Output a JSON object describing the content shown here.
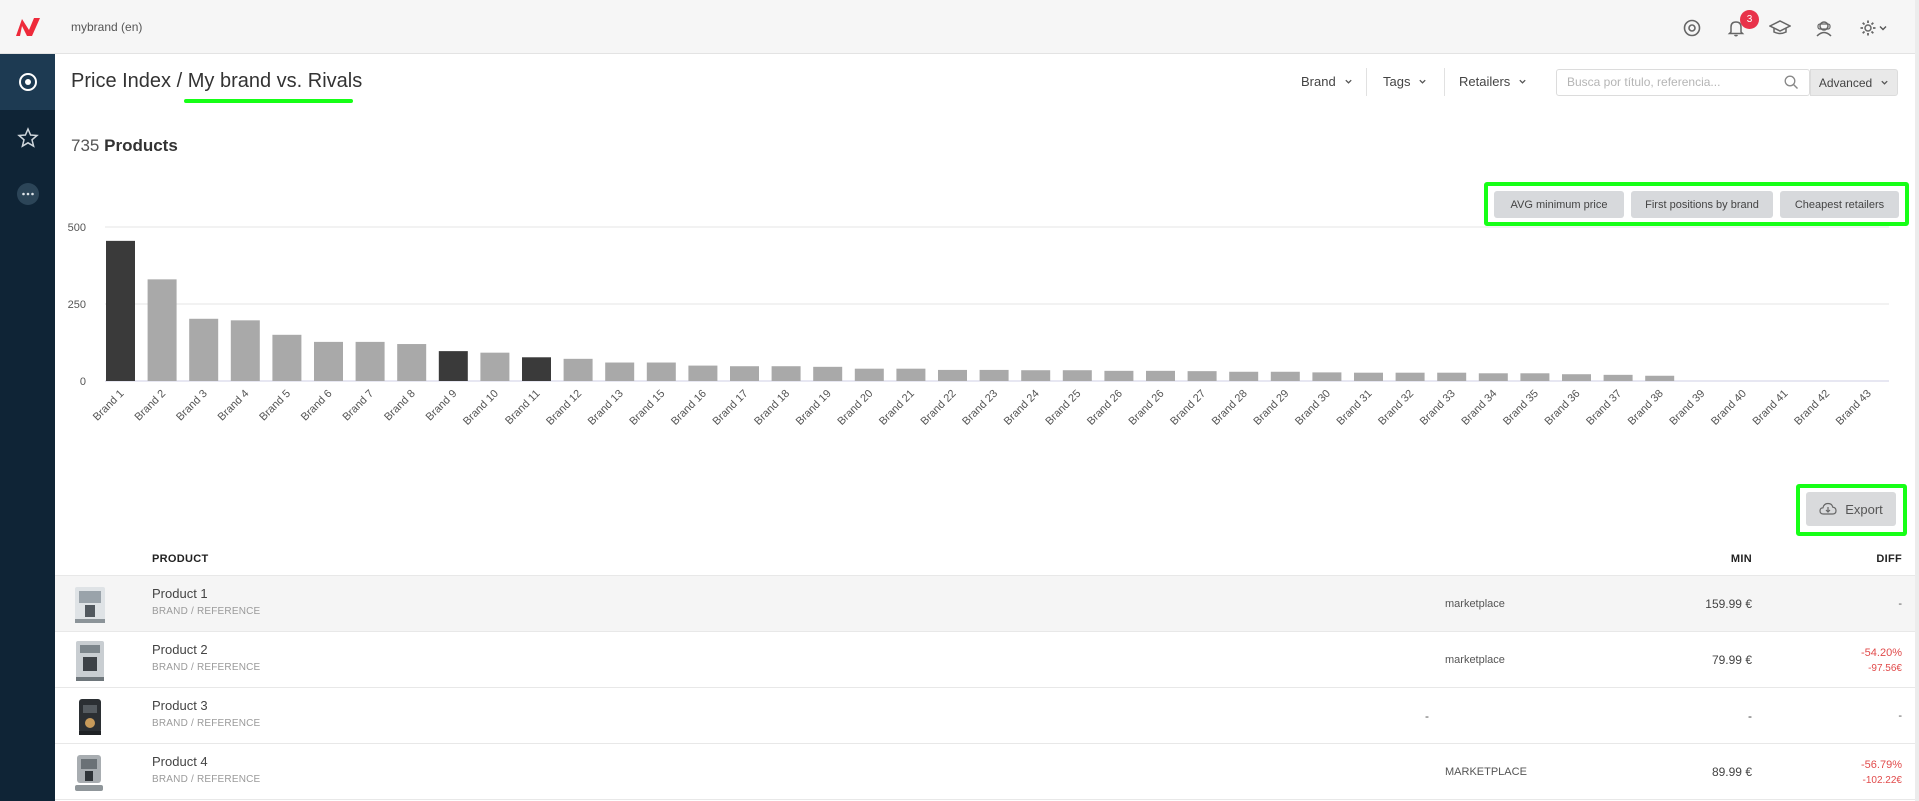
{
  "topbar": {
    "brand_label": "mybrand (en)",
    "notifications_count": "3",
    "icons": [
      "chrome-icon",
      "bell-icon",
      "graduation-cap-icon",
      "support-agent-icon",
      "gear-icon",
      "chevron-down-icon"
    ]
  },
  "sidebar": {
    "items": [
      {
        "icon": "dashboard-circle-icon",
        "active": true
      },
      {
        "icon": "star-icon",
        "active": false
      },
      {
        "icon": "more-dots-icon",
        "active": false
      }
    ]
  },
  "header": {
    "title_part1": "Price Index",
    "title_sep": " / ",
    "title_part2": "My brand vs. Rivals"
  },
  "filters": {
    "brand": "Brand",
    "tags": "Tags",
    "retailers": "Retailers",
    "search_placeholder": "Busca por título, referencia...",
    "advanced": "Advanced"
  },
  "summary": {
    "count": "735",
    "label": "Products"
  },
  "chart_tabs": [
    "AVG minimum price",
    "First positions by brand",
    "Cheapest retailers"
  ],
  "chart_data": {
    "type": "bar",
    "title": "",
    "xlabel": "",
    "ylabel": "",
    "ylim": [
      0,
      500
    ],
    "yticks": [
      0,
      250,
      500
    ],
    "grid": true,
    "categories": [
      "Brand 1",
      "Brand 2",
      "Brand 3",
      "Brand 4",
      "Brand 5",
      "Brand 6",
      "Brand 7",
      "Brand 8",
      "Brand 9",
      "Brand 10",
      "Brand 11",
      "Brand 12",
      "Brand 13",
      "Brand 15",
      "Brand 16",
      "Brand 17",
      "Brand 18",
      "Brand 19",
      "Brand 20",
      "Brand 21",
      "Brand 22",
      "Brand 23",
      "Brand 24",
      "Brand 25",
      "Brand 26",
      "Brand 26",
      "Brand 27",
      "Brand 28",
      "Brand 29",
      "Brand 30",
      "Brand 31",
      "Brand 32",
      "Brand 33",
      "Brand 34",
      "Brand 35",
      "Brand 36",
      "Brand 37",
      "Brand 38",
      "Brand 39",
      "Brand 40",
      "Brand 41",
      "Brand 42",
      "Brand 43"
    ],
    "values": [
      455,
      330,
      202,
      197,
      150,
      127,
      127,
      120,
      97,
      92,
      77,
      72,
      60,
      60,
      50,
      48,
      48,
      46,
      40,
      40,
      36,
      36,
      35,
      35,
      33,
      33,
      32,
      30,
      30,
      28,
      27,
      27,
      27,
      25,
      25,
      22,
      20,
      17,
      0,
      0,
      0,
      0,
      0
    ],
    "highlighted": [
      0,
      8,
      10
    ],
    "colors": {
      "highlight": "#3a3a3a",
      "default": "#a9a9a9",
      "grid": "#e6e6e6"
    }
  },
  "export_label": "Export",
  "table": {
    "headers": {
      "product": "PRODUCT",
      "min": "MIN",
      "diff": "DIFF"
    },
    "rows": [
      {
        "name": "Product 1",
        "sub": "BRAND / REFERENCE",
        "retailer": "marketplace",
        "min": "159.99 €",
        "diff1": "-",
        "diff2": "",
        "neg": false,
        "extra_dash": ""
      },
      {
        "name": "Product 2",
        "sub": "BRAND / REFERENCE",
        "retailer": "marketplace",
        "min": "79.99 €",
        "diff1": "-54.20%",
        "diff2": "-97.56€",
        "neg": true,
        "extra_dash": ""
      },
      {
        "name": "Product 3",
        "sub": "BRAND / REFERENCE",
        "retailer": "",
        "min": "-",
        "diff1": "-",
        "diff2": "",
        "neg": false,
        "extra_dash": "-"
      },
      {
        "name": "Product 4",
        "sub": "BRAND / REFERENCE",
        "retailer": "MARKETPLACE",
        "min": "89.99 €",
        "diff1": "-56.79%",
        "diff2": "-102.22€",
        "neg": true,
        "extra_dash": ""
      }
    ]
  }
}
